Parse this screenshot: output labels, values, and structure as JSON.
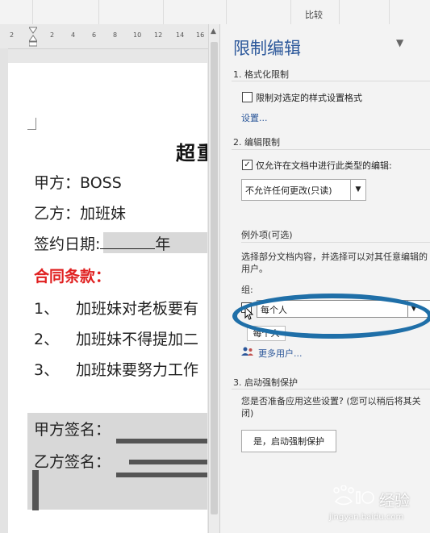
{
  "ribbon": {
    "compare_label": "比较"
  },
  "ruler": {
    "ticks": [
      "2",
      "2",
      "4",
      "6",
      "8",
      "10",
      "12",
      "14",
      "16"
    ]
  },
  "document": {
    "title": "超重",
    "party_a": "甲方：BOSS",
    "party_b": "乙方：加班妹",
    "sign_date_label": "签约日期:",
    "year_char": "年",
    "clauses_heading": "合同条款：",
    "clauses": [
      {
        "num": "1、",
        "text": "加班妹对老板要有"
      },
      {
        "num": "2、",
        "text": "加班妹不得提加二"
      },
      {
        "num": "3、",
        "text": "加班妹要努力工作"
      }
    ],
    "sign_a": "甲方签名：",
    "sign_b": "乙方签名："
  },
  "pane": {
    "title": "限制编辑",
    "section1": {
      "heading": "1. 格式化限制",
      "checkbox_label": "限制对选定的样式设置格式",
      "settings_link": "设置..."
    },
    "section2": {
      "heading": "2. 编辑限制",
      "checkbox_label": "仅允许在文档中进行此类型的编辑:",
      "checked_mark": "✓",
      "select_value": "不允许任何更改(只读)",
      "exceptions_label": "例外项(可选)",
      "exceptions_desc": "选择部分文档内容，并选择可以对其任意编辑的用户。",
      "groups_label": "组:",
      "group_value": "每个人",
      "tooltip": "每个人",
      "more_users_link": "更多用户..."
    },
    "section3": {
      "heading": "3. 启动强制保护",
      "question": "您是否准备应用这些设置? (您可以稍后将其关闭)",
      "start_button": "是，启动强制保护"
    }
  },
  "watermark": {
    "text": "经验",
    "url": "jingyan.baidu.com"
  },
  "colors": {
    "accent": "#2b579a",
    "highlight_ring": "#1f6fa8",
    "heading_red": "#e02020"
  }
}
